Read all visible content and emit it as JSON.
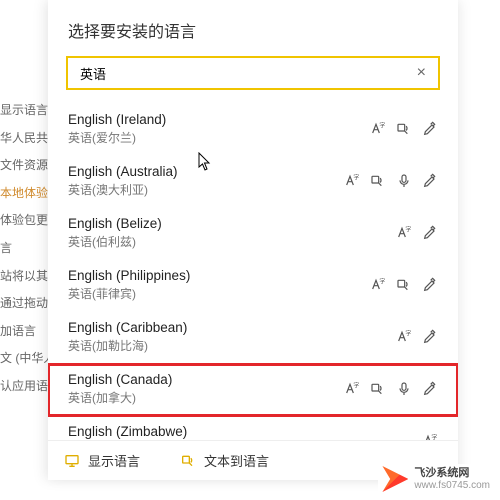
{
  "sidebar": {
    "items": [
      "显示语言",
      "华人民共",
      "文件资源",
      "本地体验性",
      "体验包更新",
      "言",
      "站将以其",
      "通过拖动",
      "加语言",
      "文 (中华人",
      "认应用语"
    ],
    "highlight_index": 3
  },
  "panel": {
    "title": "选择要安装的语言",
    "search_value": "英语"
  },
  "languages": [
    {
      "en": "English (Ireland)",
      "zh": "英语(爱尔兰)",
      "icons": [
        "font",
        "tts",
        "pen"
      ],
      "hl": false
    },
    {
      "en": "English (Australia)",
      "zh": "英语(澳大利亚)",
      "icons": [
        "font",
        "tts",
        "mic",
        "pen"
      ],
      "hl": false
    },
    {
      "en": "English (Belize)",
      "zh": "英语(伯利兹)",
      "icons": [
        "font",
        "pen"
      ],
      "hl": false
    },
    {
      "en": "English (Philippines)",
      "zh": "英语(菲律宾)",
      "icons": [
        "font",
        "tts",
        "pen"
      ],
      "hl": false
    },
    {
      "en": "English (Caribbean)",
      "zh": "英语(加勒比海)",
      "icons": [
        "font",
        "pen"
      ],
      "hl": false
    },
    {
      "en": "English (Canada)",
      "zh": "英语(加拿大)",
      "icons": [
        "font",
        "tts",
        "mic",
        "pen"
      ],
      "hl": true
    },
    {
      "en": "English (Zimbabwe)",
      "zh": "英语",
      "icons": [
        "font"
      ],
      "hl": false
    }
  ],
  "bottom_tabs": {
    "display": "显示语言",
    "tts": "文本到语言"
  },
  "watermark": {
    "name": "飞沙系统网",
    "url": "www.fs0745.com"
  }
}
